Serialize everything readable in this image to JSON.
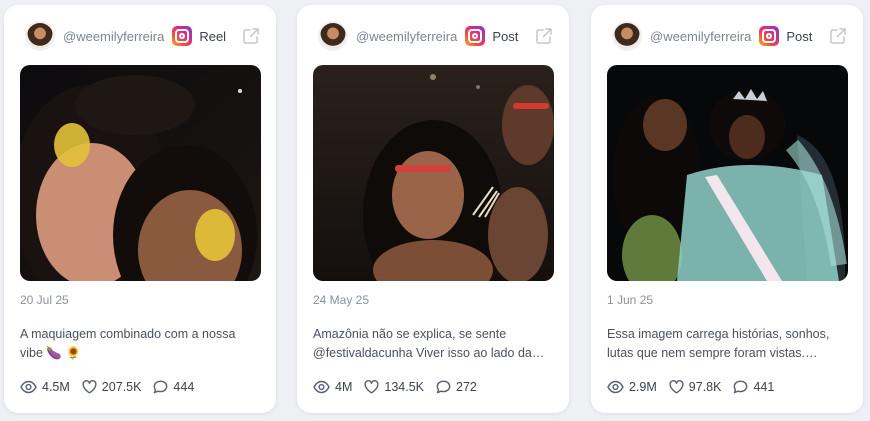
{
  "cards": [
    {
      "handle": "@weemilyferreira",
      "post_type": "Reel",
      "date": "20 Jul 25",
      "caption": "A maquiagem combinado com a nossa vibe 🍆 🌻",
      "views": "4.5M",
      "likes": "207.5K",
      "comments": "444"
    },
    {
      "handle": "@weemilyferreira",
      "post_type": "Post",
      "date": "24 May 25",
      "caption": "Amazônia não se explica, se sente @festivaldacunha Viver isso ao lado da equipe",
      "views": "4M",
      "likes": "134.5K",
      "comments": "272"
    },
    {
      "handle": "@weemilyferreira",
      "post_type": "Post",
      "date": "1 Jun 25",
      "caption": "Essa imagem carrega histórias, sonhos, lutas que nem sempre foram vistas. Mesmo assim",
      "views": "2.9M",
      "likes": "97.8K",
      "comments": "441"
    }
  ],
  "colors": {
    "background": "#eef0f4",
    "card": "#ffffff",
    "muted_text": "#8a909c",
    "body_text": "#4a5060",
    "instagram_gradient": [
      "#f9b33a",
      "#f0543c",
      "#d92e7f",
      "#7a3bd4"
    ]
  },
  "icons": {
    "platform": "instagram-icon",
    "open_external": "external-link-icon",
    "views": "eye-icon",
    "likes": "heart-icon",
    "comments": "comment-icon"
  }
}
